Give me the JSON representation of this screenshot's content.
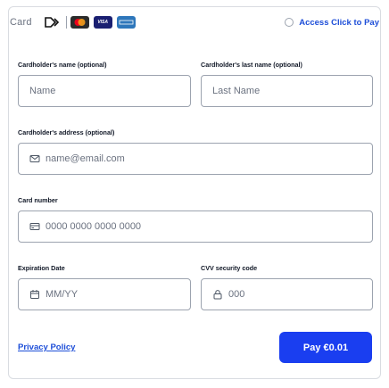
{
  "header": {
    "card_label": "Card",
    "brands": [
      "click-to-pay-logo",
      "mastercard-logo",
      "visa-logo",
      "amex-logo"
    ],
    "visa_text": "VISA",
    "access_label": "Access Click to Pay"
  },
  "fields": {
    "first_name": {
      "label": "Cardholder's name (optional)",
      "placeholder": "Name"
    },
    "last_name": {
      "label": "Cardholder's last name (optional)",
      "placeholder": "Last Name"
    },
    "address": {
      "label": "Cardholder's address (optional)",
      "placeholder": "name@email.com"
    },
    "card_number": {
      "label": "Card number",
      "placeholder": "0000 0000 0000 0000"
    },
    "expiry": {
      "label": "Expiration Date",
      "placeholder": "MM/YY"
    },
    "cvv": {
      "label": "CVV security code",
      "placeholder": "000"
    }
  },
  "footer": {
    "privacy_label": "Privacy Policy",
    "pay_label": "Pay €0.01"
  },
  "colors": {
    "accent": "#1a3ef0",
    "link": "#1d4ed8",
    "border": "#9ca3af"
  }
}
